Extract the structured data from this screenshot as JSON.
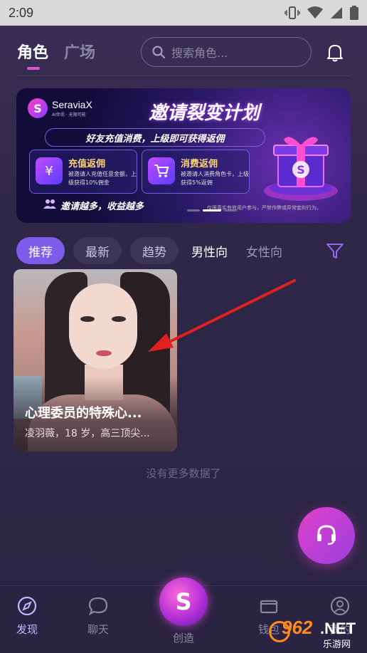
{
  "status_bar": {
    "time": "2:09"
  },
  "top_nav": {
    "tabs": [
      {
        "label": "角色",
        "active": true
      },
      {
        "label": "广场",
        "active": false
      }
    ],
    "search_placeholder": "搜索角色..."
  },
  "banner": {
    "logo_text": "SeraviaX",
    "logo_sub": "AI伴侣 · 无限可能",
    "title": "邀请裂变计划",
    "subtitle": "好友充值消费，上级即可获得返佣",
    "cards": [
      {
        "title": "充值返佣",
        "desc": "被邀请人充值任意金额，上级获得10%佣金",
        "icon": "wallet-icon"
      },
      {
        "title": "消费返佣",
        "desc": "被邀请人消费角色卡，上级获得5%返佣",
        "icon": "cart-icon"
      }
    ],
    "bottom_text": "邀请越多，收益越多",
    "disclaimer": "仅限真实有效用户参与，严禁作弊或异常套利行为。",
    "active_slide": 2,
    "slide_count": 3
  },
  "filters": {
    "chips": [
      "推荐",
      "最新",
      "趋势",
      "男性向",
      "女性向"
    ],
    "active_index": 0
  },
  "character_card": {
    "title": "心理委员的特殊心...",
    "desc": "凌羽薇，18 岁，高三顶尖..."
  },
  "list_end_text": "没有更多数据了",
  "bottom_nav": {
    "items": [
      {
        "label": "发现",
        "icon": "compass-icon",
        "active": true
      },
      {
        "label": "聊天",
        "icon": "chat-icon",
        "active": false
      },
      {
        "label": "创造",
        "icon": "create-logo-icon",
        "active": false
      },
      {
        "label": "钱包",
        "icon": "wallet-icon",
        "active": false
      },
      {
        "label": "我的",
        "icon": "user-icon",
        "active": false
      }
    ]
  },
  "watermark": {
    "num": "962",
    "net": ".NET",
    "cn": "乐游网"
  },
  "colors": {
    "accent": "#7c5ce8",
    "tab_underline": "#e24fd0",
    "fab": "#d040c8",
    "annotation_arrow": "#e02020"
  }
}
